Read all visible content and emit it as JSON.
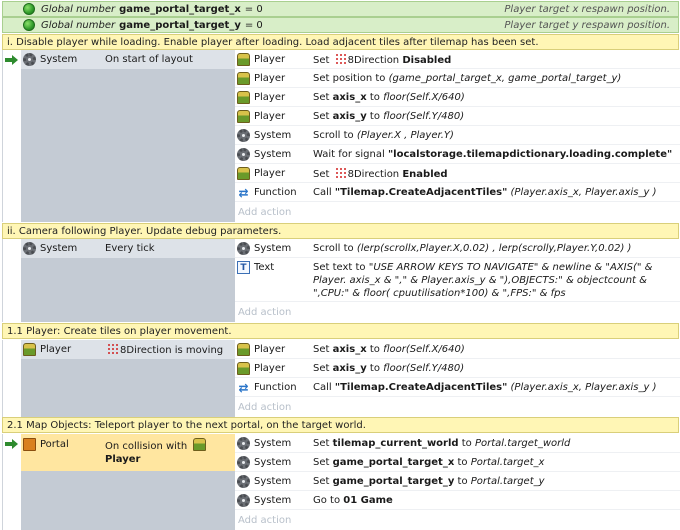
{
  "globals": [
    {
      "kw": "Global number",
      "name": "game_portal_target_x",
      "value": "= 0",
      "comment": "Player target x respawn position."
    },
    {
      "kw": "Global number",
      "name": "game_portal_target_y",
      "value": "= 0",
      "comment": "Player target y respawn position."
    }
  ],
  "comments": [
    "i. Disable player while loading. Enable player after loading. Load adjacent tiles after tilemap has been set.",
    "ii. Camera following Player. Update debug parameters.",
    "1.1 Player: Create tiles on player movement.",
    "2.1 Map Objects: Teleport player to the next portal, on the target world."
  ],
  "add_action": "Add action",
  "blocks": [
    {
      "cond": {
        "obj": "System",
        "icon": "gear-icon",
        "text": "On start of layout"
      },
      "actions": [
        {
          "obj": "Player",
          "icon": "player-icon",
          "a": "Set",
          "dots": true,
          "b": "8Direction",
          "c": "Disabled"
        },
        {
          "obj": "Player",
          "icon": "player-icon",
          "a": "Set position to",
          "i": "(game_portal_target_x, game_portal_target_y)"
        },
        {
          "obj": "Player",
          "icon": "player-icon",
          "a": "Set",
          "b": "axis_x",
          "c": "to",
          "i": "floor(Self.X/640)"
        },
        {
          "obj": "Player",
          "icon": "player-icon",
          "a": "Set",
          "b": "axis_y",
          "c": "to",
          "i": "floor(Self.Y/480)"
        },
        {
          "obj": "System",
          "icon": "gear-icon",
          "a": "Scroll to",
          "i": "(Player.X , Player.Y)"
        },
        {
          "obj": "System",
          "icon": "gear-icon",
          "a": "Wait for signal",
          "b": "\"localstorage.tilemapdictionary.loading.complete\""
        },
        {
          "obj": "Player",
          "icon": "player-icon",
          "a": "Set",
          "dots": true,
          "b": "8Direction",
          "c": "Enabled"
        },
        {
          "obj": "Function",
          "icon": "function-icon",
          "a": "Call",
          "b": "\"Tilemap.CreateAdjacentTiles\"",
          "i": "(Player.axis_x, Player.axis_y )"
        }
      ]
    },
    {
      "cond": {
        "obj": "System",
        "icon": "gear-icon",
        "text": "Every tick"
      },
      "actions": [
        {
          "obj": "System",
          "icon": "gear-icon",
          "a": "Scroll to",
          "i": "(lerp(scrollx,Player.X,0.02) , lerp(scrolly,Player.Y,0.02) )"
        },
        {
          "obj": "Text",
          "icon": "text-icon",
          "a": "Set text to",
          "i": "\"USE ARROW KEYS TO NAVIGATE\" & newline & \"AXIS(\" & Player. axis_x & \",\" & Player.axis_y & \"),OBJECTS:\" & objectcount & \",CPU:\" & floor( cpuutilisation*100) & \",FPS:\" & fps"
        }
      ]
    },
    {
      "cond": {
        "obj": "Player",
        "icon": "player-icon",
        "text": "8Direction is moving",
        "dots": true
      },
      "actions": [
        {
          "obj": "Player",
          "icon": "player-icon",
          "a": "Set",
          "b": "axis_x",
          "c": "to",
          "i": "floor(Self.X/640)"
        },
        {
          "obj": "Player",
          "icon": "player-icon",
          "a": "Set",
          "b": "axis_y",
          "c": "to",
          "i": "floor(Self.Y/480)"
        },
        {
          "obj": "Function",
          "icon": "function-icon",
          "a": "Call",
          "b": "\"Tilemap.CreateAdjacentTiles\"",
          "i": "(Player.axis_x, Player.axis_y )"
        }
      ]
    },
    {
      "cond": {
        "obj": "Portal",
        "icon": "portal-icon",
        "text": "On collision with",
        "text2": "Player"
      },
      "actions": [
        {
          "obj": "System",
          "icon": "gear-icon",
          "a": "Set",
          "b": "tilemap_current_world",
          "c": "to",
          "i": "Portal.target_world"
        },
        {
          "obj": "System",
          "icon": "gear-icon",
          "a": "Set",
          "b": "game_portal_target_x",
          "c": "to",
          "i": "Portal.target_x"
        },
        {
          "obj": "System",
          "icon": "gear-icon",
          "a": "Set",
          "b": "game_portal_target_y",
          "c": "to",
          "i": "Portal.target_y"
        },
        {
          "obj": "System",
          "icon": "gear-icon",
          "a": "Go to",
          "b": "01 Game"
        }
      ]
    }
  ]
}
